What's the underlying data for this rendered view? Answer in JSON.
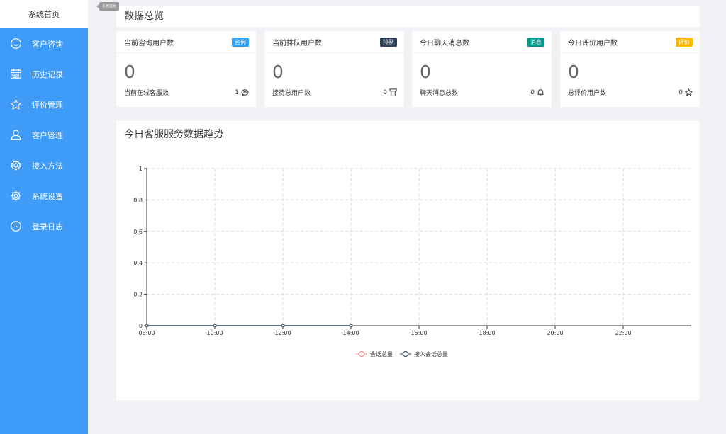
{
  "sidebar": {
    "home_label": "系统首页",
    "home_tooltip": "系统首页",
    "items": [
      {
        "label": "客户咨询",
        "icon": "smile-icon"
      },
      {
        "label": "历史记录",
        "icon": "calendar-icon"
      },
      {
        "label": "评价管理",
        "icon": "star-icon"
      },
      {
        "label": "客户管理",
        "icon": "user-icon"
      },
      {
        "label": "接入方法",
        "icon": "gear-icon"
      },
      {
        "label": "系统设置",
        "icon": "settings-icon"
      },
      {
        "label": "登录日志",
        "icon": "clock-icon"
      }
    ]
  },
  "overview_title": "数据总览",
  "cards": [
    {
      "title": "当前咨询用户数",
      "badge": "咨询",
      "badge_color": "#2d9ff6",
      "value": "0",
      "foot_label": "当前在线客服数",
      "foot_value": "1",
      "icon": "chat-icon"
    },
    {
      "title": "当前排队用户数",
      "badge": "排队",
      "badge_color": "#2f4056",
      "value": "0",
      "foot_label": "接待总用户数",
      "foot_value": "0",
      "icon": "queue-icon"
    },
    {
      "title": "今日聊天消息数",
      "badge": "消息",
      "badge_color": "#009688",
      "value": "0",
      "foot_label": "聊天消息总数",
      "foot_value": "0",
      "icon": "bell-icon"
    },
    {
      "title": "今日评价用户数",
      "badge": "评价",
      "badge_color": "#ffb800",
      "value": "0",
      "foot_label": "总评价用户数",
      "foot_value": "0",
      "icon": "star-icon"
    }
  ],
  "chart_title": "今日客服服务数据趋势",
  "chart_data": {
    "type": "line",
    "categories": [
      "08:00",
      "10:00",
      "12:00",
      "14:00",
      "16:00",
      "18:00",
      "20:00",
      "22:00"
    ],
    "series": [
      {
        "name": "会话总量",
        "values": [
          0,
          0,
          0,
          0
        ],
        "color": "#f08080"
      },
      {
        "name": "接入会话总量",
        "values": [
          0,
          0,
          0,
          0
        ],
        "color": "#2f4056"
      }
    ],
    "y_ticks": [
      "0",
      "0.2",
      "0.4",
      "0.6",
      "0.8",
      "1"
    ],
    "ylim": [
      0,
      1
    ],
    "grid": true,
    "legend": "bottom-center"
  }
}
